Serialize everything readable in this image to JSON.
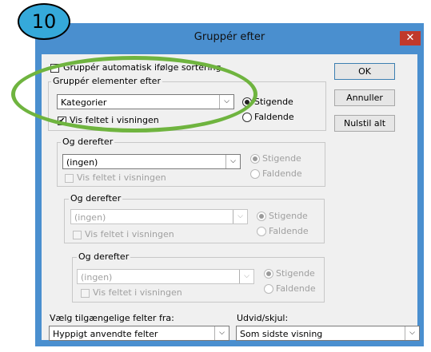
{
  "badge": "10",
  "window": {
    "title": "Gruppér efter",
    "close_glyph": "✕"
  },
  "auto_group": {
    "label": "Gruppér automatisk ifølge sortering",
    "checked": false
  },
  "groups": [
    {
      "legend": "Gruppér elementer efter",
      "field": "Kategorier",
      "show_field_label": "Vis feltet i visningen",
      "show_field_checked": true,
      "ascending_label": "Stigende",
      "descending_label": "Faldende",
      "order": "ascending",
      "enabled": true
    },
    {
      "legend": "Og derefter",
      "field": "(ingen)",
      "show_field_label": "Vis feltet i visningen",
      "show_field_checked": false,
      "ascending_label": "Stigende",
      "descending_label": "Faldende",
      "order": "ascending",
      "enabled": false
    },
    {
      "legend": "Og derefter",
      "field": "(ingen)",
      "show_field_label": "Vis feltet i visningen",
      "show_field_checked": false,
      "ascending_label": "Stigende",
      "descending_label": "Faldende",
      "order": "ascending",
      "enabled": false
    },
    {
      "legend": "Og derefter",
      "field": "(ingen)",
      "show_field_label": "Vis feltet i visningen",
      "show_field_checked": false,
      "ascending_label": "Stigende",
      "descending_label": "Faldende",
      "order": "ascending",
      "enabled": false
    }
  ],
  "buttons": {
    "ok": "OK",
    "cancel": "Annuller",
    "reset": "Nulstil alt"
  },
  "choose_fields": {
    "label": "Vælg tilgængelige felter fra:",
    "value": "Hyppigt anvendte felter"
  },
  "expand": {
    "label": "Udvid/skjul:",
    "value": "Som sidste visning"
  },
  "colors": {
    "frame": "#4a8fcf",
    "badge": "#35a9da",
    "highlight": "#6fb43f",
    "close": "#c0392b"
  }
}
